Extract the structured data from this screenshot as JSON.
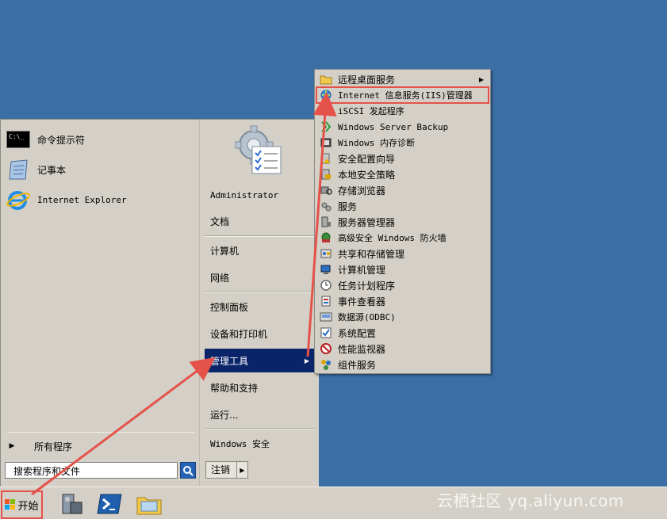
{
  "start_menu": {
    "pinned": [
      {
        "label": "命令提示符",
        "icon": "cmd-icon"
      },
      {
        "label": "记事本",
        "icon": "notepad-icon"
      },
      {
        "label": "Internet Explorer",
        "icon": "ie-icon"
      }
    ],
    "all_programs": "所有程序",
    "search_placeholder": "搜索程序和文件",
    "right_items": {
      "user": "Administrator",
      "documents": "文档",
      "computer": "计算机",
      "network": "网络",
      "control_panel": "控制面板",
      "devices": "设备和打印机",
      "admin_tools": "管理工具",
      "help": "帮助和支持",
      "run": "运行...",
      "security": "Windows 安全"
    },
    "logoff": "注销"
  },
  "admin_tools_submenu": [
    {
      "label": "远程桌面服务",
      "icon": "folder-icon",
      "has_submenu": true
    },
    {
      "label": "Internet 信息服务(IIS)管理器",
      "icon": "iis-icon",
      "highlighted": true
    },
    {
      "label": "iSCSI 发起程序",
      "icon": "iscsi-icon"
    },
    {
      "label": "Windows Server Backup",
      "icon": "backup-icon"
    },
    {
      "label": "Windows 内存诊断",
      "icon": "memory-icon"
    },
    {
      "label": "安全配置向导",
      "icon": "security-wizard-icon"
    },
    {
      "label": "本地安全策略",
      "icon": "local-policy-icon"
    },
    {
      "label": "存储浏览器",
      "icon": "storage-icon"
    },
    {
      "label": "服务",
      "icon": "services-icon"
    },
    {
      "label": "服务器管理器",
      "icon": "server-manager-icon"
    },
    {
      "label": "高级安全 Windows 防火墙",
      "icon": "firewall-icon"
    },
    {
      "label": "共享和存储管理",
      "icon": "share-icon"
    },
    {
      "label": "计算机管理",
      "icon": "computer-mgmt-icon"
    },
    {
      "label": "任务计划程序",
      "icon": "task-scheduler-icon"
    },
    {
      "label": "事件查看器",
      "icon": "event-viewer-icon"
    },
    {
      "label": "数据源(ODBC)",
      "icon": "odbc-icon"
    },
    {
      "label": "系统配置",
      "icon": "msconfig-icon"
    },
    {
      "label": "性能监视器",
      "icon": "perfmon-icon"
    },
    {
      "label": "组件服务",
      "icon": "component-services-icon"
    }
  ],
  "taskbar": {
    "start": "开始",
    "pinned": [
      "server-manager-icon",
      "powershell-icon",
      "explorer-icon"
    ]
  },
  "watermark": "云栖社区 yq.aliyun.com",
  "colors": {
    "desktop": "#3a6ea5",
    "selection": "#0a246a",
    "annotation": "#e5524a"
  }
}
